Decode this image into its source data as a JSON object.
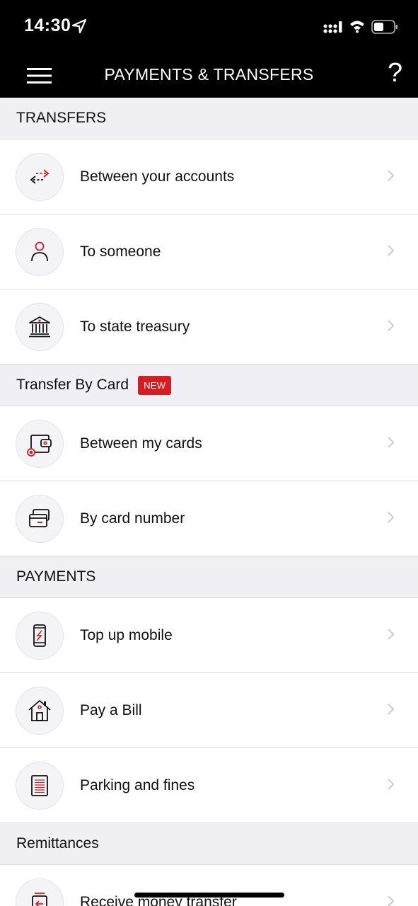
{
  "status": {
    "time": "14:30"
  },
  "nav": {
    "title": "PAYMENTS & TRANSFERS",
    "help": "?"
  },
  "sections": [
    {
      "title": "TRANSFERS",
      "items": [
        "Between your accounts",
        "To someone",
        "To state treasury"
      ]
    },
    {
      "title": "Transfer By Card",
      "badge": "NEW",
      "items": [
        "Between my cards",
        "By card number"
      ]
    },
    {
      "title": "PAYMENTS",
      "items": [
        "Top up mobile",
        "Pay a Bill",
        "Parking and fines"
      ]
    },
    {
      "title": "Remittances",
      "items": [
        "Receive money transfer"
      ]
    }
  ],
  "colors": {
    "accent": "#e0191f",
    "header": "#000000",
    "section_bg": "#efeff4"
  },
  "icons": [
    "arrows-transfer-icon",
    "person-icon",
    "bank-building-icon",
    "wallet-card-icon",
    "cards-stack-icon",
    "mobile-phone-icon",
    "house-icon",
    "document-icon",
    "receive-money-icon"
  ]
}
